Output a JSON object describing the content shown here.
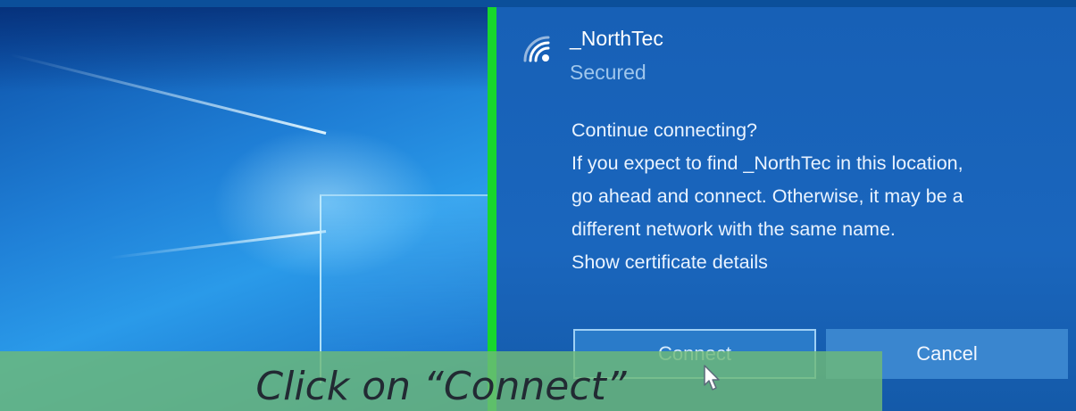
{
  "network": {
    "name": "_NorthTec",
    "status": "Secured",
    "icon": "wifi-signal-icon"
  },
  "dialog": {
    "question": "Continue connecting?",
    "message_lines": [
      "If you expect to find _NorthTec in this location,",
      "go ahead and connect. Otherwise, it may be a",
      "different network with the same name."
    ],
    "certificate_link": "Show certificate details"
  },
  "buttons": {
    "connect": "Connect",
    "cancel": "Cancel"
  },
  "caption": "Click on “Connect”",
  "colors": {
    "flyout_background": "#1a66bd",
    "divider": "#17d72c",
    "caption_background": "#6eb978"
  }
}
